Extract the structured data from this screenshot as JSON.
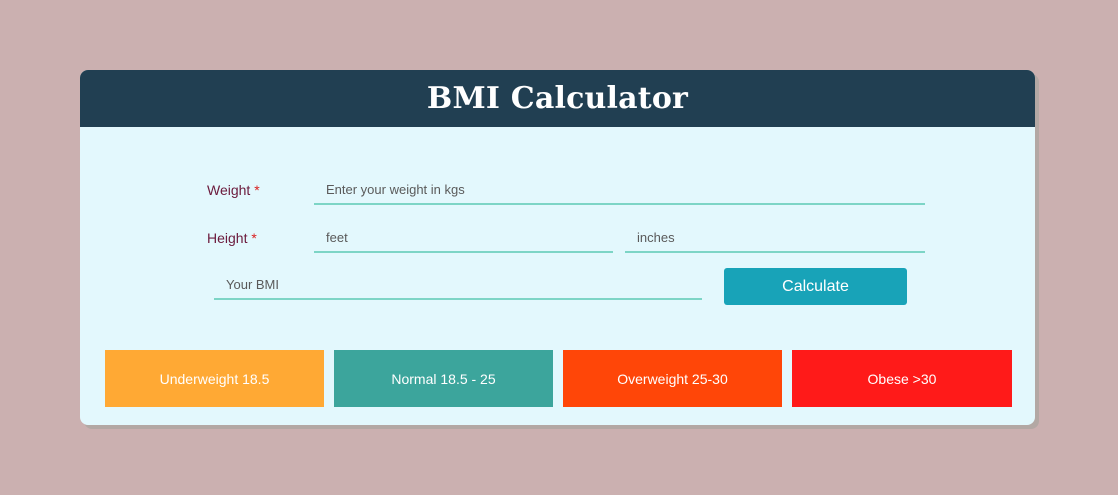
{
  "app": {
    "title": "BMI Calculator"
  },
  "form": {
    "weight": {
      "label": "Weight",
      "required_mark": "*",
      "placeholder": "Enter your weight in kgs",
      "value": ""
    },
    "height": {
      "label": "Height",
      "required_mark": "*",
      "feet_placeholder": "feet",
      "inches_placeholder": "inches"
    },
    "result": {
      "placeholder": "Your BMI",
      "value": ""
    },
    "calculate_label": "Calculate"
  },
  "ranges": [
    {
      "label": "Underweight 18.5",
      "color": "#ffa934"
    },
    {
      "label": "Normal 18.5 - 25",
      "color": "#3ca59c"
    },
    {
      "label": "Overweight 25-30",
      "color": "#ff4608"
    },
    {
      "label": "Obese >30",
      "color": "#ff1a19"
    }
  ],
  "colors": {
    "page_background": "#cbb0b0",
    "card_background": "#e3f8fd",
    "header_background": "#213f52",
    "accent": "#18a3b8",
    "field_underline": "#7dd5c6",
    "label_text": "#6b1a3c",
    "required_mark": "#d92020"
  }
}
